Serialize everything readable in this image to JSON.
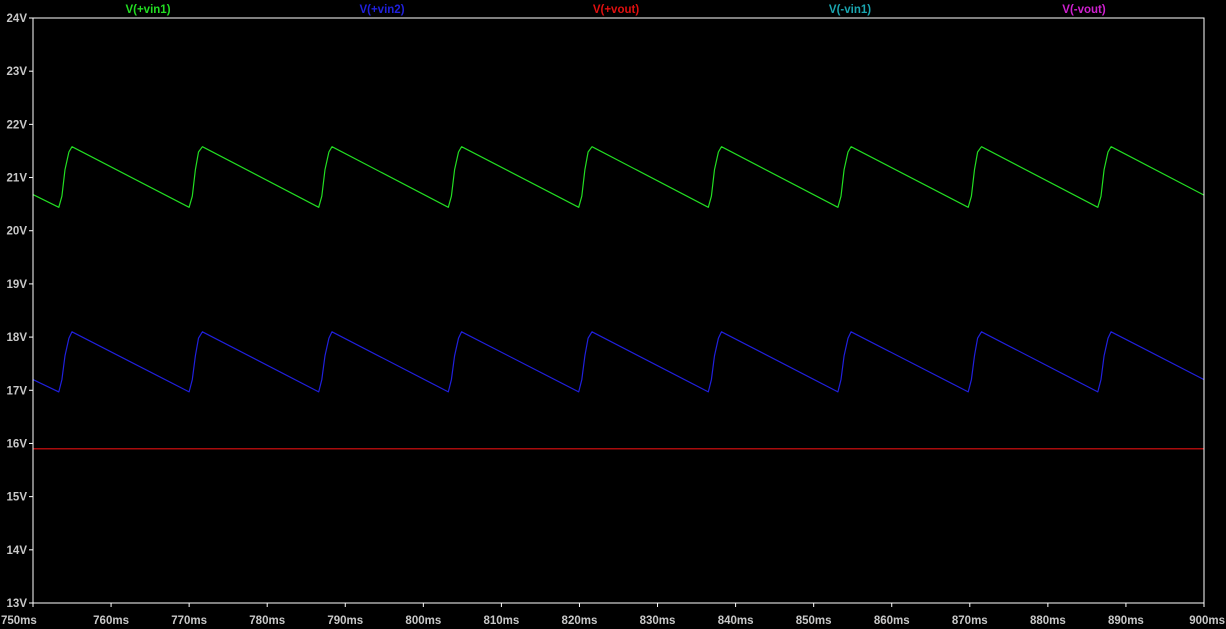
{
  "chart_data": {
    "type": "line",
    "title": "",
    "xlabel": "",
    "ylabel": "",
    "background": "#000000",
    "frame_color": "#ffffff",
    "tick_label_color": "#c8c8c8",
    "grid": false,
    "legend_position": "top",
    "xlim": [
      750,
      900
    ],
    "ylim": [
      13,
      24
    ],
    "x_ticks": [
      750,
      760,
      770,
      780,
      790,
      800,
      810,
      820,
      830,
      840,
      850,
      860,
      870,
      880,
      890,
      900
    ],
    "x_tick_labels": [
      "750ms",
      "760ms",
      "770ms",
      "780ms",
      "790ms",
      "800ms",
      "810ms",
      "820ms",
      "830ms",
      "840ms",
      "850ms",
      "860ms",
      "870ms",
      "880ms",
      "890ms",
      "900ms"
    ],
    "y_ticks": [
      13,
      14,
      15,
      16,
      17,
      18,
      19,
      20,
      21,
      22,
      23,
      24
    ],
    "y_tick_labels": [
      "13V",
      "14V",
      "15V",
      "16V",
      "17V",
      "18V",
      "19V",
      "20V",
      "21V",
      "22V",
      "23V",
      "24V"
    ],
    "series": [
      {
        "name": "V(+vin1)",
        "color": "#22dd22",
        "x": [
          750,
          753.3,
          753.7,
          754.1,
          754.6,
          755.0,
          770.0,
          770.4,
          770.8,
          771.2,
          771.7,
          786.6,
          787.0,
          787.4,
          787.9,
          788.3,
          803.2,
          803.6,
          804.0,
          804.5,
          804.9,
          819.9,
          820.3,
          820.7,
          821.1,
          821.6,
          836.5,
          836.9,
          837.3,
          837.8,
          838.2,
          853.1,
          853.5,
          853.9,
          854.4,
          854.8,
          869.8,
          870.2,
          870.6,
          871.0,
          871.5,
          886.4,
          886.8,
          887.2,
          887.7,
          888.1,
          900
        ],
        "y": [
          20.68,
          20.44,
          20.65,
          21.15,
          21.48,
          21.58,
          20.44,
          20.65,
          21.15,
          21.48,
          21.58,
          20.44,
          20.65,
          21.15,
          21.48,
          21.58,
          20.44,
          20.65,
          21.15,
          21.48,
          21.58,
          20.44,
          20.65,
          21.15,
          21.48,
          21.58,
          20.44,
          20.65,
          21.15,
          21.48,
          21.58,
          20.44,
          20.65,
          21.15,
          21.48,
          21.58,
          20.44,
          20.65,
          21.15,
          21.48,
          21.58,
          20.44,
          20.65,
          21.15,
          21.48,
          21.58,
          20.67
        ]
      },
      {
        "name": "V(+vin2)",
        "color": "#2020dd",
        "x": [
          750,
          753.3,
          753.7,
          754.1,
          754.6,
          755.0,
          770.0,
          770.4,
          770.8,
          771.2,
          771.7,
          786.6,
          787.0,
          787.4,
          787.9,
          788.3,
          803.2,
          803.6,
          804.0,
          804.5,
          804.9,
          819.9,
          820.3,
          820.7,
          821.1,
          821.6,
          836.5,
          836.9,
          837.3,
          837.8,
          838.2,
          853.1,
          853.5,
          853.9,
          854.4,
          854.8,
          869.8,
          870.2,
          870.6,
          871.0,
          871.5,
          886.4,
          886.8,
          887.2,
          887.7,
          888.1,
          900
        ],
        "y": [
          17.2,
          16.97,
          17.2,
          17.65,
          17.98,
          18.1,
          16.97,
          17.2,
          17.65,
          17.98,
          18.1,
          16.97,
          17.2,
          17.65,
          17.98,
          18.1,
          16.97,
          17.2,
          17.65,
          17.98,
          18.1,
          16.97,
          17.2,
          17.65,
          17.98,
          18.1,
          16.97,
          17.2,
          17.65,
          17.98,
          18.1,
          16.97,
          17.2,
          17.65,
          17.98,
          18.1,
          16.97,
          17.2,
          17.65,
          17.98,
          18.1,
          16.97,
          17.2,
          17.65,
          17.98,
          18.1,
          17.2
        ]
      },
      {
        "name": "V(+vout)",
        "color": "#e01010",
        "x": [
          750,
          900
        ],
        "y": [
          15.9,
          15.9
        ]
      },
      {
        "name": "V(-vin1)",
        "color": "#1aa6b0",
        "x": [],
        "y": []
      },
      {
        "name": "V(-vout)",
        "color": "#d020d0",
        "x": [],
        "y": []
      }
    ]
  }
}
